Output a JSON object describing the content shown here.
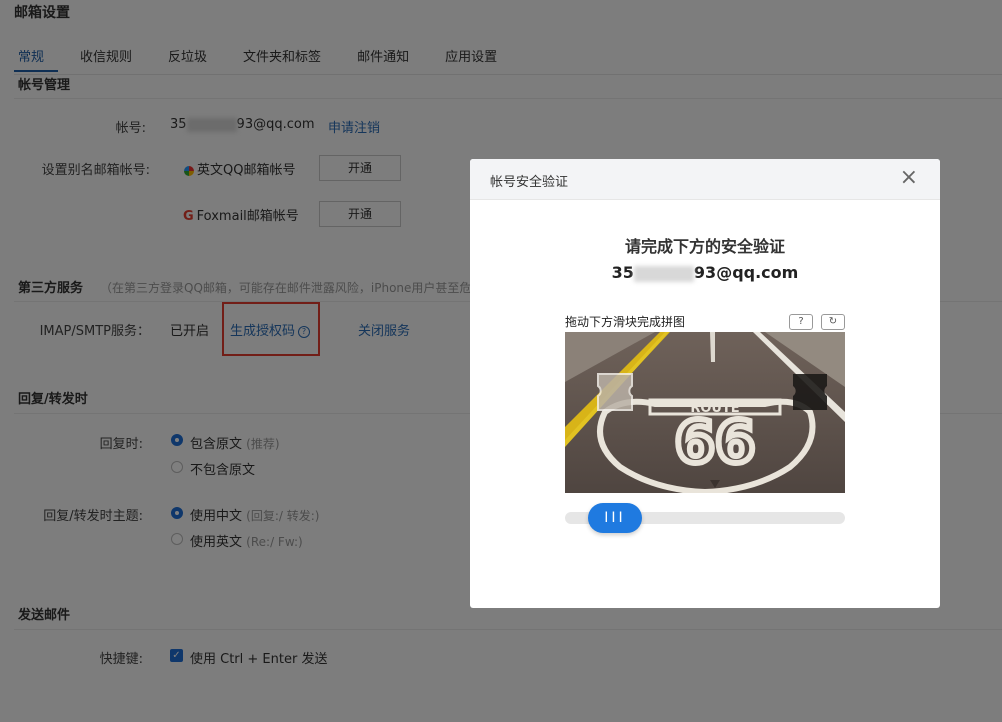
{
  "page": {
    "title": "邮箱设置"
  },
  "tabs": [
    {
      "label": "常规"
    },
    {
      "label": "收信规则"
    },
    {
      "label": "反垃圾"
    },
    {
      "label": "文件夹和标签"
    },
    {
      "label": "邮件通知"
    },
    {
      "label": "应用设置"
    }
  ],
  "account": {
    "section_title": "帐号管理",
    "account_label": "帐号:",
    "account_prefix": "35",
    "account_suffix": "93@qq.com",
    "cancel_link": "申请注销",
    "alias_label": "设置别名邮箱帐号:",
    "english_qq_label": "英文QQ邮箱帐号",
    "foxmail_label": "Foxmail邮箱帐号",
    "enable_btn": "开通"
  },
  "third_party": {
    "section_title": "第三方服务",
    "note": "（在第三方登录QQ邮箱，可能存在邮件泄露风险，iPhone用户甚至危害",
    "imap_label": "IMAP/SMTP服务：",
    "status": "已开启",
    "generate_link": "生成授权码",
    "close_link": "关闭服务"
  },
  "reply": {
    "section_title": "回复/转发时",
    "reply_label": "回复时:",
    "opt_include": "包含原文",
    "opt_include_note": "(推荐)",
    "opt_exclude": "不包含原文",
    "subject_label": "回复/转发时主题:",
    "opt_chinese": "使用中文",
    "opt_chinese_note": "(回复:/ 转发:)",
    "opt_english": "使用英文",
    "opt_english_note": "(Re:/ Fw:)"
  },
  "send": {
    "section_title": "发送邮件",
    "shortcut_label": "快捷键:",
    "shortcut_value": "使用 Ctrl + Enter 发送"
  },
  "modal": {
    "title": "帐号安全验证",
    "close_icon": "×",
    "heading": "请完成下方的安全验证",
    "account_prefix": "35",
    "account_suffix": "93@qq.com",
    "puzzle_hint": "拖动下方滑块完成拼图",
    "help_icon": "?",
    "refresh_icon": "↻",
    "road_text": "ROUTE",
    "road_number": "66",
    "slider_handle": "III",
    "slider_progress": 0.12
  }
}
